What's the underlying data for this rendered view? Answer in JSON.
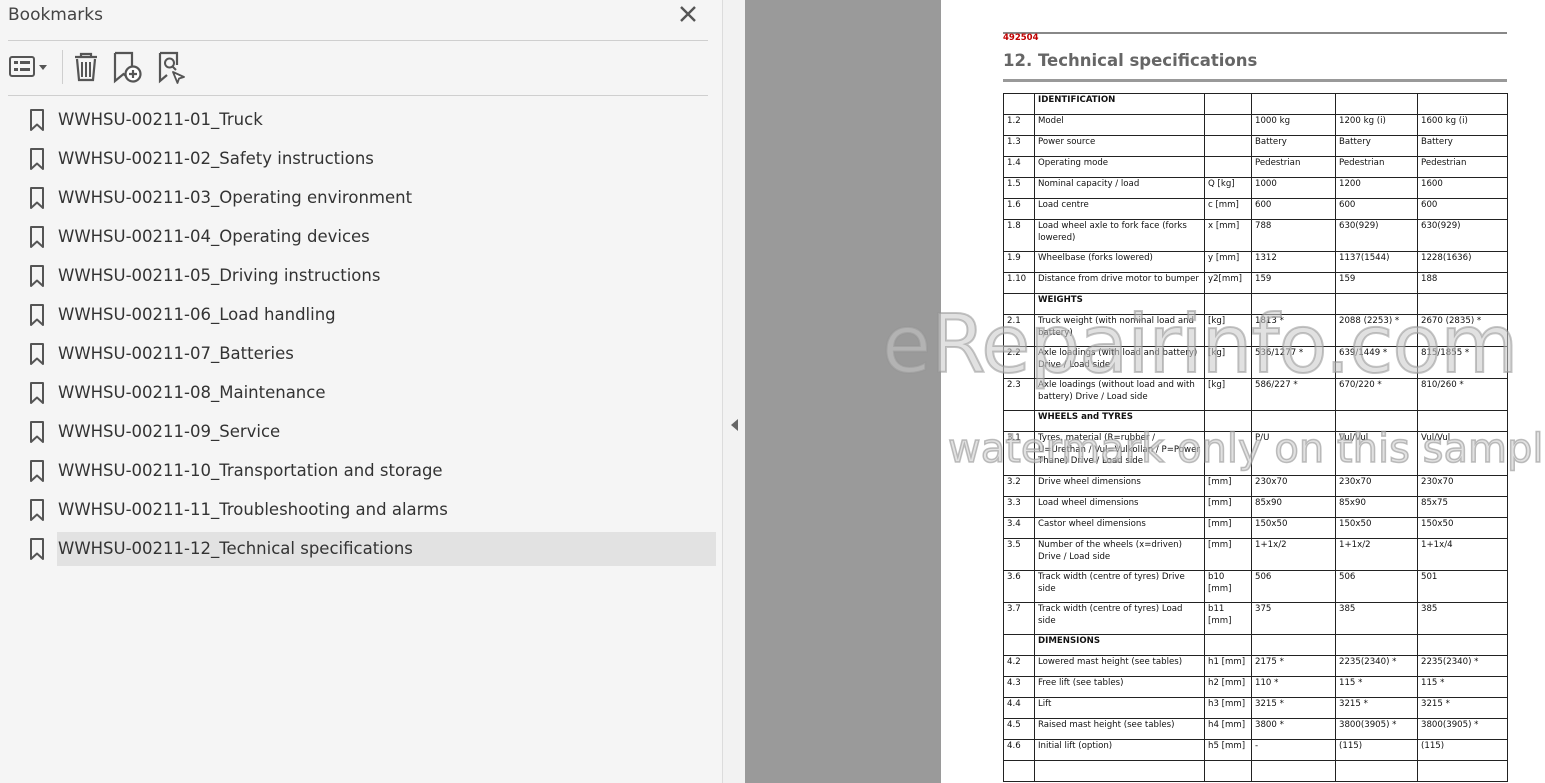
{
  "panel": {
    "title": "Bookmarks",
    "close_icon": "close-icon",
    "toolbar": [
      "options-menu-icon",
      "delete-icon",
      "add-bookmark-icon",
      "find-bookmark-icon"
    ],
    "selected_index": 11,
    "items": [
      {
        "label": "WWHSU-00211-01_Truck"
      },
      {
        "label": "WWHSU-00211-02_Safety instructions"
      },
      {
        "label": "WWHSU-00211-03_Operating environment"
      },
      {
        "label": "WWHSU-00211-04_Operating devices"
      },
      {
        "label": "WWHSU-00211-05_Driving instructions"
      },
      {
        "label": "WWHSU-00211-06_Load handling"
      },
      {
        "label": "WWHSU-00211-07_Batteries"
      },
      {
        "label": "WWHSU-00211-08_Maintenance"
      },
      {
        "label": "WWHSU-00211-09_Service"
      },
      {
        "label": "WWHSU-00211-10_Transportation and storage"
      },
      {
        "label": "WWHSU-00211-11_Troubleshooting and alarms"
      },
      {
        "label": "WWHSU-00211-12_Technical specifications"
      }
    ]
  },
  "document": {
    "doc_number": "492504",
    "title": "12. Technical specifications",
    "rows": [
      {
        "type": "section",
        "cells": [
          "",
          "IDENTIFICATION",
          "",
          "",
          "",
          ""
        ]
      },
      {
        "type": "row",
        "cells": [
          "1.2",
          "Model",
          "",
          "1000 kg",
          "1200 kg (i)",
          "1600 kg (i)"
        ]
      },
      {
        "type": "row",
        "cells": [
          "1.3",
          "Power source",
          "",
          "Battery",
          "Battery",
          "Battery"
        ]
      },
      {
        "type": "row",
        "cells": [
          "1.4",
          "Operating mode",
          "",
          "Pedestrian",
          "Pedestrian",
          "Pedestrian"
        ]
      },
      {
        "type": "row",
        "cells": [
          "1.5",
          "Nominal capacity / load",
          "Q [kg]",
          "1000",
          "1200",
          "1600"
        ]
      },
      {
        "type": "row",
        "cells": [
          "1.6",
          "Load centre",
          "c [mm]",
          "600",
          "600",
          "600"
        ]
      },
      {
        "type": "row2",
        "cells": [
          "1.8",
          "Load wheel axle to fork face (forks lowered)",
          "x [mm]",
          "788",
          "630(929)",
          "630(929)"
        ]
      },
      {
        "type": "row",
        "cells": [
          "1.9",
          "Wheelbase (forks lowered)",
          "y [mm]",
          "1312",
          "1137(1544)",
          "1228(1636)"
        ]
      },
      {
        "type": "row",
        "cells": [
          "1.10",
          "Distance from drive motor to bumper",
          "y2[mm]",
          "159",
          "159",
          "188"
        ]
      },
      {
        "type": "section",
        "cells": [
          "",
          "WEIGHTS",
          "",
          "",
          "",
          ""
        ]
      },
      {
        "type": "row2",
        "cells": [
          "2.1",
          "Truck weight (with nominal load and battery)",
          "[kg]",
          "1813 *",
          "2088 (2253) *",
          "2670 (2835) *"
        ]
      },
      {
        "type": "row2",
        "cells": [
          "2.2",
          "Axle loadings (with load and battery) Drive / Load side",
          "[kg]",
          "536/1277 *",
          "639/1449 *",
          "815/1855 *"
        ]
      },
      {
        "type": "row2",
        "cells": [
          "2.3",
          "Axle loadings (without load and with battery) Drive / Load side",
          "[kg]",
          "586/227 *",
          "670/220 *",
          "810/260 *"
        ]
      },
      {
        "type": "section",
        "cells": [
          "",
          "WHEELS and TYRES",
          "",
          "",
          "",
          ""
        ]
      },
      {
        "type": "row3",
        "cells": [
          "3.1",
          "Tyres, material (R=rubber / U=Urethan / Vul=Vulkollan / P=Power Thane) Drive / Load side",
          "",
          "P/U",
          "Vul/Vul",
          "Vul/Vul"
        ]
      },
      {
        "type": "row",
        "cells": [
          "3.2",
          "Drive wheel dimensions",
          "[mm]",
          "230x70",
          "230x70",
          "230x70"
        ]
      },
      {
        "type": "row",
        "cells": [
          "3.3",
          "Load wheel dimensions",
          "[mm]",
          "85x90",
          "85x90",
          "85x75"
        ]
      },
      {
        "type": "row",
        "cells": [
          "3.4",
          "Castor wheel dimensions",
          "[mm]",
          "150x50",
          "150x50",
          "150x50"
        ]
      },
      {
        "type": "row2",
        "cells": [
          "3.5",
          "Number of the wheels (x=driven) Drive / Load side",
          "[mm]",
          "1+1x/2",
          "1+1x/2",
          "1+1x/4"
        ]
      },
      {
        "type": "row2",
        "cells": [
          "3.6",
          "Track width (centre of tyres) Drive side",
          "b10 [mm]",
          "506",
          "506",
          "501"
        ]
      },
      {
        "type": "row2",
        "cells": [
          "3.7",
          "Track width (centre of tyres) Load side",
          "b11 [mm]",
          "375",
          "385",
          "385"
        ]
      },
      {
        "type": "section",
        "cells": [
          "",
          "DIMENSIONS",
          "",
          "",
          "",
          ""
        ]
      },
      {
        "type": "row",
        "cells": [
          "4.2",
          "Lowered mast height (see tables)",
          "h1 [mm]",
          "2175 *",
          "2235(2340) *",
          "2235(2340) *"
        ]
      },
      {
        "type": "row",
        "cells": [
          "4.3",
          "Free lift (see tables)",
          "h2 [mm]",
          "110 *",
          "115 *",
          "115 *"
        ]
      },
      {
        "type": "row",
        "cells": [
          "4.4",
          "Lift",
          "h3 [mm]",
          "3215 *",
          "3215 *",
          "3215 *"
        ]
      },
      {
        "type": "row",
        "cells": [
          "4.5",
          "Raised mast height (see tables)",
          "h4 [mm]",
          "3800 *",
          "3800(3905) *",
          "3800(3905) *"
        ]
      },
      {
        "type": "row",
        "cells": [
          "4.6",
          "Initial lift (option)",
          "h5 [mm]",
          "-",
          "(115)",
          "(115)"
        ]
      },
      {
        "type": "row",
        "cells": [
          "",
          "",
          "",
          "",
          "",
          ""
        ]
      }
    ]
  },
  "watermark": {
    "line1": "eRepairinfo.com",
    "line2": "watermark only on this sample"
  }
}
